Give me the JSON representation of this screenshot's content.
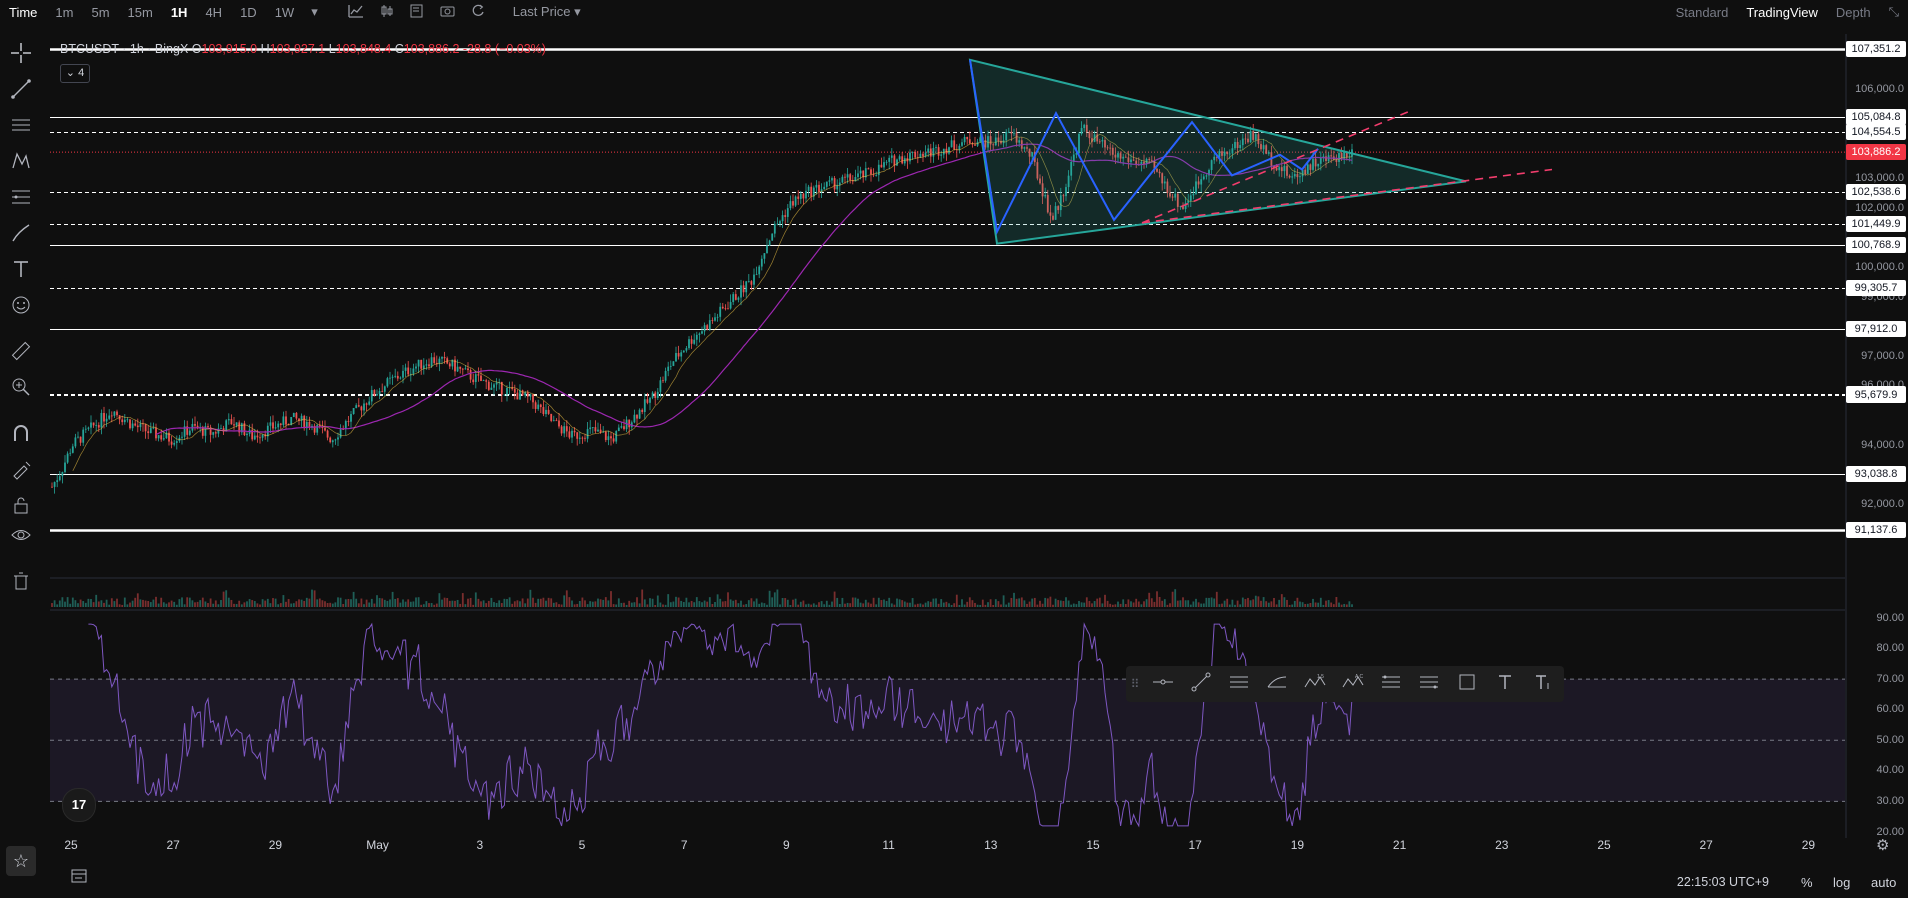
{
  "toolbar": {
    "timeframes": [
      "Time",
      "1m",
      "5m",
      "15m",
      "1H",
      "4H",
      "1D",
      "1W"
    ],
    "active_timeframe": "1H",
    "price_type": "Last Price",
    "views": [
      "Standard",
      "TradingView",
      "Depth"
    ],
    "active_view": "TradingView"
  },
  "legend": {
    "symbol": "BTCUSDT · 1h · BingX",
    "o_label": "O",
    "o": "103,915.0",
    "h_label": "H",
    "h": "103,927.1",
    "l_label": "L",
    "l": "103,848.4",
    "c_label": "C",
    "c": "103,886.2",
    "change": "-28.8 (−0.03%)",
    "indicator_count": "4"
  },
  "price_scale": {
    "ticks": [
      "106,000.0",
      "103,000.0",
      "102,000.0",
      "100,000.0",
      "99,000.0",
      "97,000.0",
      "96,000.0",
      "94,000.0",
      "92,000.0",
      "90.00",
      "80.00",
      "70.00",
      "60.00",
      "50.00",
      "40.00",
      "30.00",
      "20.00"
    ],
    "level_badges": [
      "107,351.2",
      "105,084.8",
      "104,554.5",
      "102,538.6",
      "101,449.9",
      "100,768.9",
      "99,305.7",
      "97,912.0",
      "95,740.6",
      "95,679.9",
      "93,038.8",
      "91,137.6"
    ],
    "current_price": "103,886.2"
  },
  "time_axis": [
    "25",
    "27",
    "29",
    "May",
    "3",
    "5",
    "7",
    "9",
    "11",
    "13",
    "15",
    "17",
    "19",
    "21",
    "23",
    "25",
    "27",
    "29"
  ],
  "bottom": {
    "clock": "22:15:03 UTC+9",
    "options": [
      "%",
      "log",
      "auto"
    ]
  },
  "colors": {
    "background": "#0f0f0f",
    "up": "#26a69a",
    "down": "#ef5350",
    "ma": "#9c27b0",
    "rsi": "#7e57c2",
    "triangle": "#26a69a",
    "pattern": "#2962ff",
    "projection": "#f23d6d",
    "current": "#f23645"
  },
  "chart_data": {
    "type": "candlestick",
    "symbol": "BTCUSDT",
    "interval": "1h",
    "exchange": "BingX",
    "price_range": [
      90400,
      107600
    ],
    "ohlc_last": {
      "open": 103915.0,
      "high": 103927.1,
      "low": 103848.4,
      "close": 103886.2
    },
    "price_path": [
      [
        0,
        92600
      ],
      [
        10,
        93200
      ],
      [
        20,
        94000
      ],
      [
        40,
        94600
      ],
      [
        60,
        95200
      ],
      [
        80,
        94700
      ],
      [
        100,
        94400
      ],
      [
        120,
        94200
      ],
      [
        140,
        94600
      ],
      [
        160,
        94400
      ],
      [
        180,
        94800
      ],
      [
        200,
        94300
      ],
      [
        220,
        94600
      ],
      [
        240,
        94900
      ],
      [
        260,
        94700
      ],
      [
        280,
        94200
      ],
      [
        300,
        95000
      ],
      [
        320,
        95700
      ],
      [
        340,
        96200
      ],
      [
        360,
        96600
      ],
      [
        380,
        96900
      ],
      [
        400,
        96700
      ],
      [
        420,
        96300
      ],
      [
        440,
        96000
      ],
      [
        460,
        95800
      ],
      [
        480,
        95500
      ],
      [
        500,
        94800
      ],
      [
        520,
        94300
      ],
      [
        540,
        94500
      ],
      [
        560,
        94200
      ],
      [
        580,
        94900
      ],
      [
        600,
        95600
      ],
      [
        620,
        96800
      ],
      [
        640,
        97600
      ],
      [
        660,
        98200
      ],
      [
        680,
        98900
      ],
      [
        700,
        99600
      ],
      [
        720,
        101200
      ],
      [
        740,
        102200
      ],
      [
        760,
        102600
      ],
      [
        780,
        102800
      ],
      [
        800,
        103000
      ],
      [
        820,
        103200
      ],
      [
        840,
        103600
      ],
      [
        860,
        103800
      ],
      [
        880,
        103900
      ],
      [
        900,
        104100
      ],
      [
        920,
        104300
      ],
      [
        940,
        104200
      ],
      [
        960,
        104500
      ],
      [
        980,
        103700
      ],
      [
        1000,
        101600
      ],
      [
        1010,
        102400
      ],
      [
        1030,
        104700
      ],
      [
        1060,
        103800
      ],
      [
        1100,
        103400
      ],
      [
        1130,
        102000
      ],
      [
        1160,
        103600
      ],
      [
        1180,
        104000
      ],
      [
        1200,
        104500
      ],
      [
        1220,
        103600
      ],
      [
        1240,
        103000
      ],
      [
        1260,
        103500
      ],
      [
        1280,
        103700
      ],
      [
        1300,
        103900
      ]
    ],
    "levels": [
      107351.2,
      105084.8,
      104554.5,
      102538.6,
      101449.9,
      100768.9,
      99305.7,
      97912.0,
      95740.6,
      95679.9,
      93038.8,
      91137.6
    ],
    "rsi": {
      "range": [
        20,
        90
      ],
      "bands": [
        30,
        50,
        70
      ]
    }
  }
}
